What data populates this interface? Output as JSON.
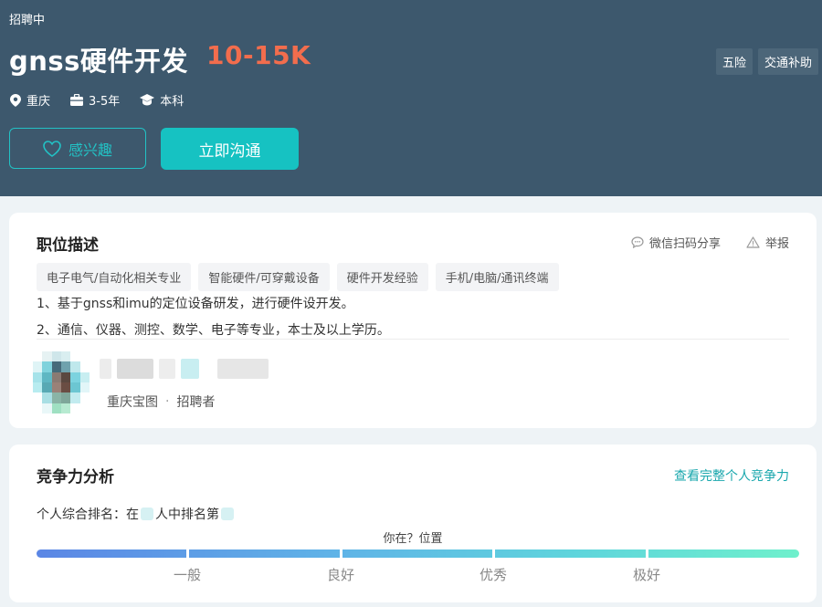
{
  "job": {
    "status": "招聘中",
    "title": "gnss硬件开发",
    "salary": "10-15K",
    "perks": [
      "五险",
      "交通补助"
    ],
    "location": "重庆",
    "experience": "3-5年",
    "education": "本科",
    "interest_label": "感兴趣",
    "chat_label": "立即沟通"
  },
  "description": {
    "title": "职位描述",
    "share_label": "微信扫码分享",
    "report_label": "举报",
    "tags": [
      "电子电气/自动化相关专业",
      "智能硬件/可穿戴设备",
      "硬件开发经验",
      "手机/电脑/通讯终端"
    ],
    "lines": [
      "1、基于gnss和imu的定位设备研发，进行硬件设开发。",
      "2、通信、仪器、测控、数学、电子等专业，本士及以上学历。"
    ]
  },
  "recruiter": {
    "company": "重庆宝图",
    "separator": "·",
    "role": "招聘者"
  },
  "competition": {
    "title": "竞争力分析",
    "link": "查看完整个人竞争力",
    "rank_prefix": "个人综合排名：在",
    "rank_middle": "人中排名第",
    "position_label": "你在？位置",
    "levels": [
      "一般",
      "良好",
      "优秀",
      "极好"
    ]
  },
  "colors": {
    "header_bg": "#3d586d",
    "salary": "#f26d4d",
    "accent": "#16c2c2",
    "link": "#19a7ad"
  }
}
